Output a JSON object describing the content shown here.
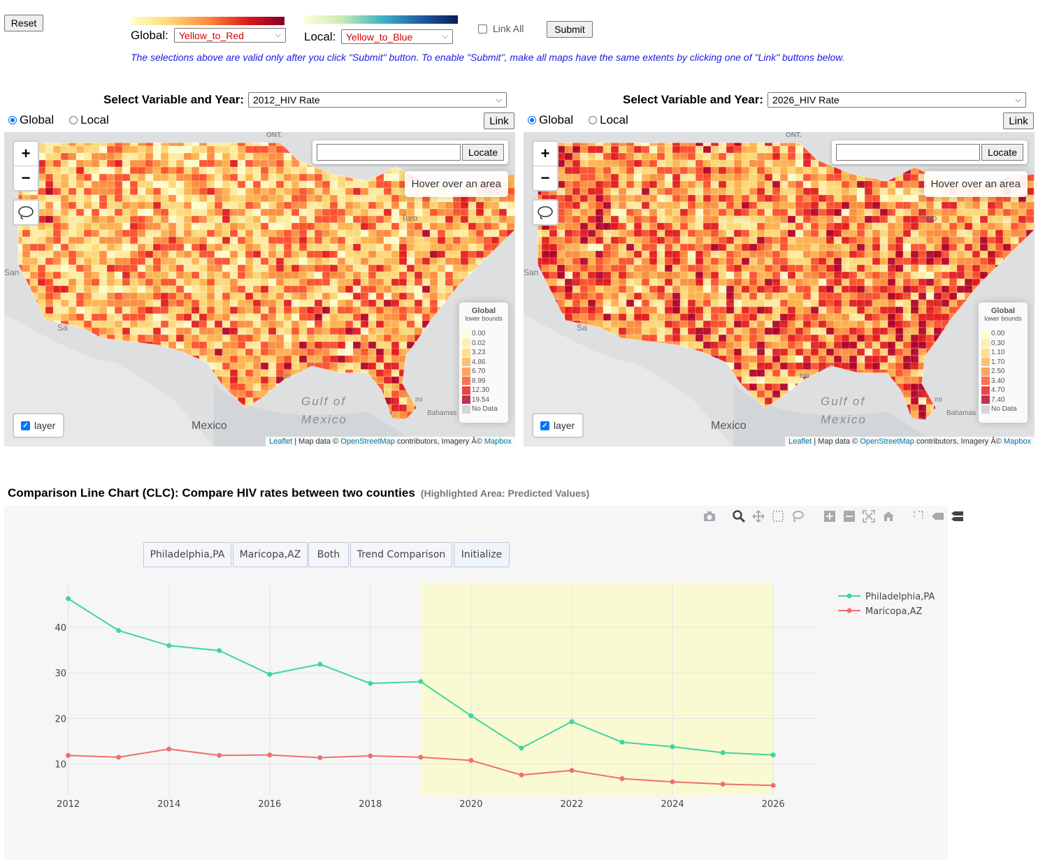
{
  "top": {
    "reset_label": "Reset",
    "global_label": "Global:",
    "global_value": "Yellow_to_Red",
    "local_label": "Local:",
    "local_value": "Yellow_to_Blue",
    "link_all_label": "Link All",
    "submit_label": "Submit",
    "note": "The selections above are valid only after you click \"Submit\" button. To enable \"Submit\", make all maps have the same extents by clicking one of \"Link\" buttons below."
  },
  "maps": [
    {
      "select_label": "Select Variable and Year:",
      "select_value": "2012_HIV Rate",
      "radio_global": "Global",
      "radio_local": "Local",
      "link_label": "Link",
      "locate_label": "Locate",
      "locate_placeholder": "",
      "hover_text": "Hover over an area",
      "legend_title": "Global",
      "legend_subtitle": "lower bounds",
      "legend_items": [
        "0.00",
        "0.02",
        "3.23",
        "4.86",
        "6.70",
        "8.99",
        "12.30",
        "19.54",
        "No Data"
      ],
      "layer_label": "layer",
      "places": {
        "ont": "ONT.",
        "toronto": "Toro",
        "san": "San",
        "gulf1": "Gulf of",
        "gulf2": "Mexico",
        "mexico": "Mexico",
        "bahamas": "Bahamas",
        "ton": "ton",
        "mi": "mi",
        "sa": "Sa"
      }
    },
    {
      "select_label": "Select Variable and Year:",
      "select_value": "2026_HIV Rate",
      "radio_global": "Global",
      "radio_local": "Local",
      "link_label": "Link",
      "locate_label": "Locate",
      "locate_placeholder": "",
      "hover_text": "Hover over an area",
      "legend_title": "Global",
      "legend_subtitle": "lower bounds",
      "legend_items": [
        "0.00",
        "0.30",
        "1.10",
        "1.70",
        "2.50",
        "3.40",
        "4.70",
        "7.40",
        "No Data"
      ],
      "layer_label": "layer",
      "places": {
        "ont": "ONT.",
        "toronto": "Toro",
        "san": "San",
        "gulf1": "Gulf of",
        "gulf2": "Mexico",
        "mexico": "Mexico",
        "bahamas": "Bahamas",
        "ton": "ton",
        "mi": "mi",
        "sa": "Sa"
      }
    }
  ],
  "attribution": {
    "leaflet": "Leaflet",
    "sep": " | Map data © ",
    "osm": "OpenStreetMap",
    "mid": " contributors, Imagery Â© ",
    "mapbox": "Mapbox"
  },
  "legend_colors": [
    "#ffffcc",
    "#ffeda0",
    "#fed976",
    "#feb24c",
    "#fd8d3c",
    "#fc4e2a",
    "#e31a1c",
    "#b10026",
    "#cccccc"
  ],
  "clc": {
    "title": "Comparison Line Chart (CLC): Compare HIV rates between two counties",
    "subtitle": "(Highlighted Area: Predicted Values)",
    "buttons": [
      "Philadelphia,PA",
      "Maricopa,AZ",
      "Both",
      "Trend Comparison",
      "Initialize"
    ]
  },
  "chart_data": {
    "type": "line",
    "x": [
      2012,
      2013,
      2014,
      2015,
      2016,
      2017,
      2018,
      2019,
      2020,
      2021,
      2022,
      2023,
      2024,
      2025,
      2026
    ],
    "series": [
      {
        "name": "Philadelphia,PA",
        "color": "#3dd6a0",
        "values": [
          46.3,
          39.3,
          36.0,
          34.9,
          29.7,
          31.9,
          27.7,
          28.1,
          20.6,
          13.5,
          19.3,
          14.8,
          13.8,
          12.5,
          12.0
        ]
      },
      {
        "name": "Maricopa,AZ",
        "color": "#ef6f6c",
        "values": [
          11.9,
          11.5,
          13.3,
          11.9,
          12.0,
          11.4,
          11.8,
          11.5,
          10.8,
          7.6,
          8.6,
          6.8,
          6.1,
          5.6,
          5.3
        ]
      }
    ],
    "xticks": [
      2012,
      2014,
      2016,
      2018,
      2020,
      2022,
      2024,
      2026
    ],
    "yticks": [
      10,
      20,
      30,
      40
    ],
    "xlim": [
      2011.7,
      2026.9
    ],
    "ylim": [
      3.2,
      49.5
    ],
    "highlight_range": [
      2019,
      2026
    ],
    "highlight_color": "#fafad2",
    "legend_position": "top-right",
    "grid": true
  }
}
